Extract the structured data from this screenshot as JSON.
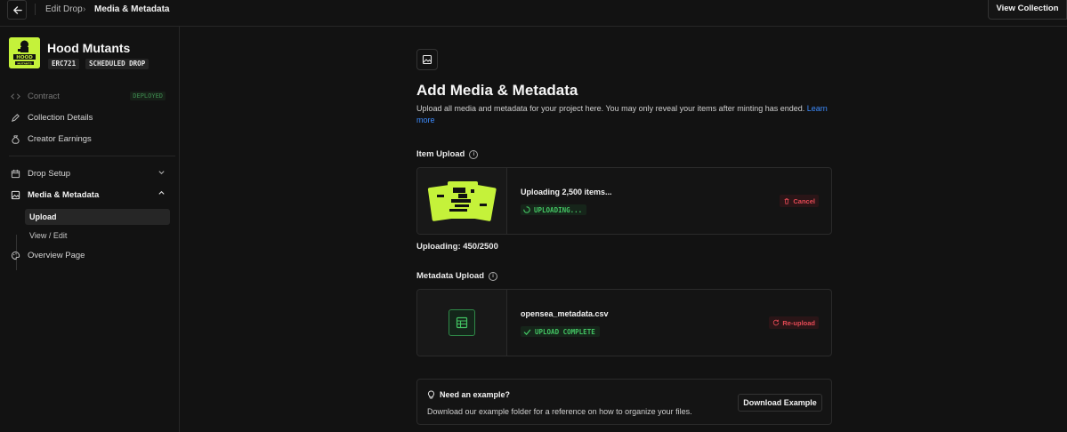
{
  "topbar": {
    "breadcrumb": [
      "Edit Drop",
      "Media & Metadata"
    ],
    "breadcrumb_sep": "›",
    "view_collection_label": "View Collection"
  },
  "project": {
    "name": "Hood Mutants",
    "tags": [
      "ERC721",
      "SCHEDULED DROP"
    ],
    "logo_text": [
      "HOOD",
      "MUTANTS"
    ]
  },
  "sidebar": {
    "items": [
      {
        "label": "Contract",
        "icon": "code-icon",
        "badge": "DEPLOYED"
      },
      {
        "label": "Collection Details",
        "icon": "pencil-icon"
      },
      {
        "label": "Creator Earnings",
        "icon": "money-bag-icon"
      },
      {
        "label": "Drop Setup",
        "icon": "calendar-icon"
      },
      {
        "label": "Media & Metadata",
        "icon": "image-icon"
      },
      {
        "label": "Overview Page",
        "icon": "palette-icon"
      }
    ],
    "sub_items": [
      {
        "label": "Upload"
      },
      {
        "label": "View / Edit"
      }
    ]
  },
  "main": {
    "title": "Add Media & Metadata",
    "description": "Upload all media and metadata for your project here. You may only reveal your items after minting has ended.",
    "learn_more": "Learn more",
    "item_upload": {
      "label": "Item Upload",
      "file_name": "Uploading 2,500 items...",
      "status": "UPLOADING...",
      "action": "Cancel",
      "progress_text": "Uploading: 450/2500",
      "progress": {
        "done": 450,
        "total": 2500
      }
    },
    "metadata_upload": {
      "label": "Metadata Upload",
      "file_name": "opensea_metadata.csv",
      "status": "UPLOAD COMPLETE",
      "action": "Re-upload"
    },
    "example": {
      "title": "Need an example?",
      "description": "Download our example folder for a reference on how to organize your files.",
      "button": "Download Example"
    }
  },
  "colors": {
    "accent_green": "#43c463",
    "brand_lime": "#c5f23a",
    "danger_red": "#e54a55",
    "link_blue": "#3d8bfd"
  }
}
